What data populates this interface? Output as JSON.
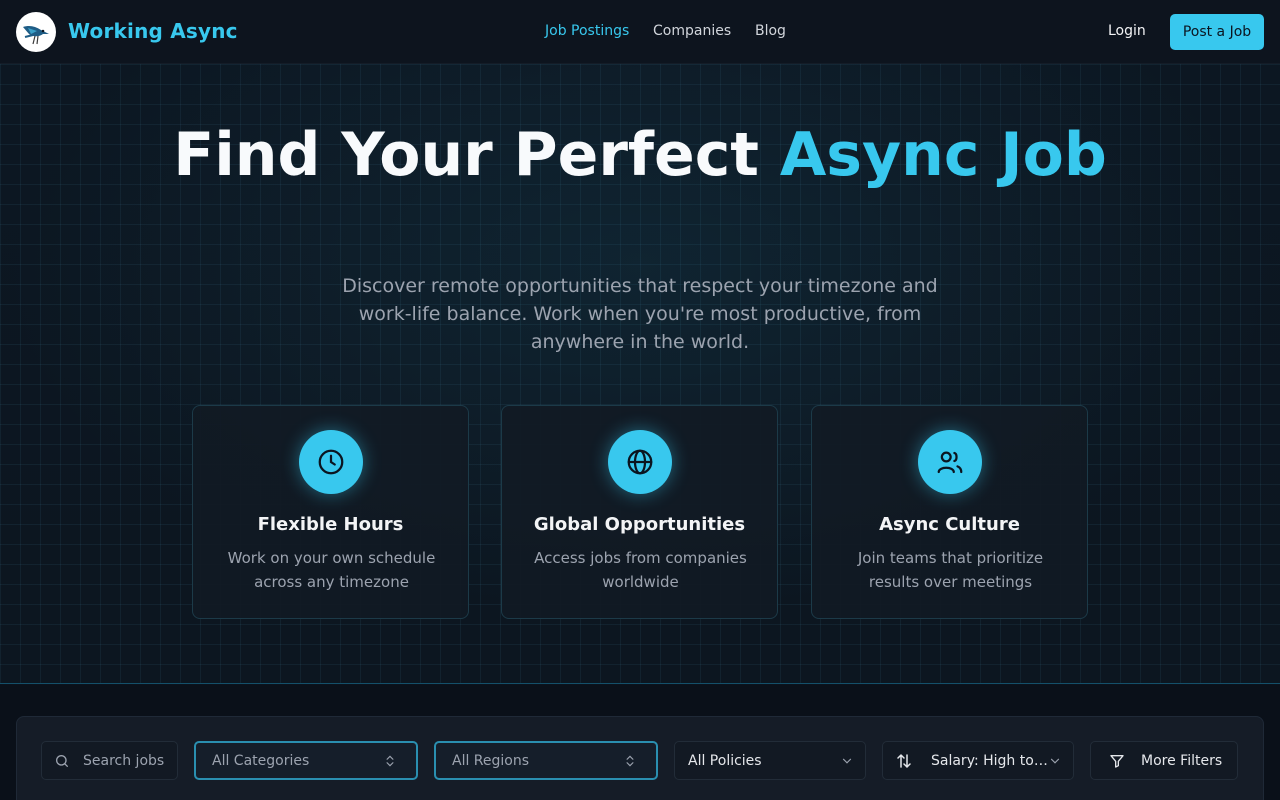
{
  "brand": {
    "name": "Working Async"
  },
  "nav": {
    "links": [
      {
        "label": "Job Postings",
        "active": true
      },
      {
        "label": "Companies",
        "active": false
      },
      {
        "label": "Blog",
        "active": false
      }
    ],
    "login": "Login",
    "post_job": "Post a Job"
  },
  "hero": {
    "title_main": "Find Your Perfect ",
    "title_accent": "Async Job",
    "subtitle": "Discover remote opportunities that respect your timezone and work-life balance. Work when you're most productive, from anywhere in the world."
  },
  "features": [
    {
      "icon": "clock-icon",
      "title": "Flexible Hours",
      "description": "Work on your own schedule across any timezone"
    },
    {
      "icon": "globe-icon",
      "title": "Global Opportunities",
      "description": "Access jobs from companies worldwide"
    },
    {
      "icon": "users-icon",
      "title": "Async Culture",
      "description": "Join teams that prioritize results over meetings"
    }
  ],
  "filters": {
    "search_placeholder": "Search jobs",
    "category": "All Categories",
    "region": "All Regions",
    "policy": "All Policies",
    "sort": "Salary: High to Low",
    "more": "More Filters"
  },
  "colors": {
    "accent": "#38c8ee",
    "background": "#0b121c",
    "card": "#111a24"
  }
}
